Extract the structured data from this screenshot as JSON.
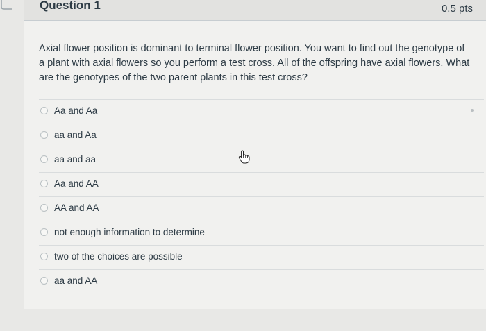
{
  "question": {
    "title": "Question 1",
    "points": "0.5 pts",
    "prompt": "Axial flower position is dominant to terminal flower position. You want to find out the genotype of a plant with axial flowers so you perform a test cross. All of the offspring have axial flowers. What are the genotypes of the two parent plants in this test cross?"
  },
  "answers": [
    {
      "label": "Aa and Aa",
      "selected": false
    },
    {
      "label": "aa and Aa",
      "selected": false
    },
    {
      "label": "aa and aa",
      "selected": false
    },
    {
      "label": "Aa and AA",
      "selected": false
    },
    {
      "label": "AA and AA",
      "selected": false
    },
    {
      "label": "not enough information to determine",
      "selected": false
    },
    {
      "label": "two of the choices are possible",
      "selected": false
    },
    {
      "label": "aa and AA",
      "selected": false
    }
  ],
  "icons": {
    "cursor": "hand-pointer-icon",
    "radio": "radio-button-icon"
  },
  "colors": {
    "text": "#2d3b45",
    "border": "#c7cdd1",
    "background": "#f1f1ef"
  }
}
